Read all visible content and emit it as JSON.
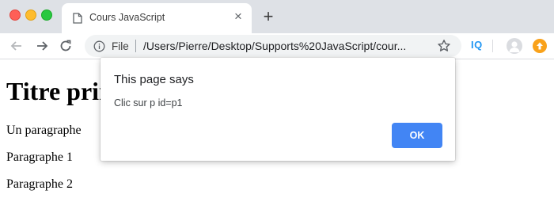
{
  "browser": {
    "tab": {
      "title": "Cours JavaScript",
      "close_glyph": "×"
    },
    "new_tab_glyph": "+",
    "omnibox": {
      "scheme_label": "File",
      "url": "/Users/Pierre/Desktop/Supports%20JavaScript/cour..."
    },
    "extension_label": "IQ",
    "icons": [
      "back-arrow-icon",
      "forward-arrow-icon",
      "reload-icon",
      "info-icon",
      "star-icon",
      "avatar-icon",
      "update-icon",
      "document-icon"
    ]
  },
  "page": {
    "heading": "Titre principal",
    "paragraphs": [
      "Un paragraphe",
      "Paragraphe 1",
      "Paragraphe 2"
    ]
  },
  "dialog": {
    "title": "This page says",
    "message": "Clic sur p id=p1",
    "ok_label": "OK"
  },
  "colors": {
    "accent": "#4285f4",
    "tabstrip": "#dee1e6",
    "omnibox": "#f1f3f4"
  }
}
